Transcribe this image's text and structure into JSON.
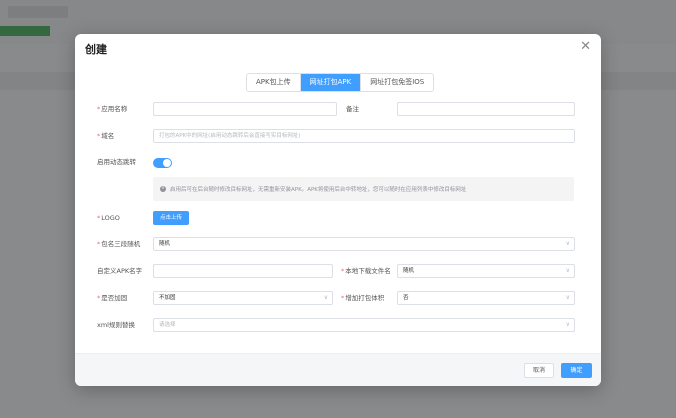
{
  "dialog": {
    "title": "创建",
    "close": "✕"
  },
  "tabs": [
    {
      "label": "APK包上传",
      "active": false
    },
    {
      "label": "网址打包APK",
      "active": true
    },
    {
      "label": "网址打包免签IOS",
      "active": false
    }
  ],
  "form": {
    "app_name": {
      "label": "应用名称",
      "value": "",
      "required": true
    },
    "remark": {
      "label": "备注",
      "value": ""
    },
    "domain": {
      "label": "域名",
      "placeholder": "打包的APK中的网址(启用动态跳转后会直接写实目标网址)",
      "required": true
    },
    "dynamic_redirect": {
      "label": "启用动态跳转",
      "enabled": true
    },
    "tip": "启用后可在后台随时修改目标网址，无需重新安装APK。APK将使用后台中转地址，您可以随时在应用列表中修改目标网址",
    "logo": {
      "label": "LOGO",
      "button": "点击上传",
      "required": true
    },
    "package_random": {
      "label": "包名三段随机",
      "value": "随机",
      "required": true
    },
    "custom_apk_name": {
      "label": "自定义APK名字",
      "value": ""
    },
    "local_filename": {
      "label": "本地下载文件名",
      "value": "随机",
      "required": true
    },
    "reinforce": {
      "label": "是否加固",
      "value": "不加固",
      "required": true
    },
    "increase_size": {
      "label": "增加打包体积",
      "value": "否",
      "required": true
    },
    "xml_obfuscate": {
      "label": "xml规则替换",
      "placeholder": "请选择"
    }
  },
  "footer": {
    "cancel": "取消",
    "confirm": "确定"
  },
  "colors": {
    "primary": "#409eff",
    "required": "#f56c6c"
  }
}
